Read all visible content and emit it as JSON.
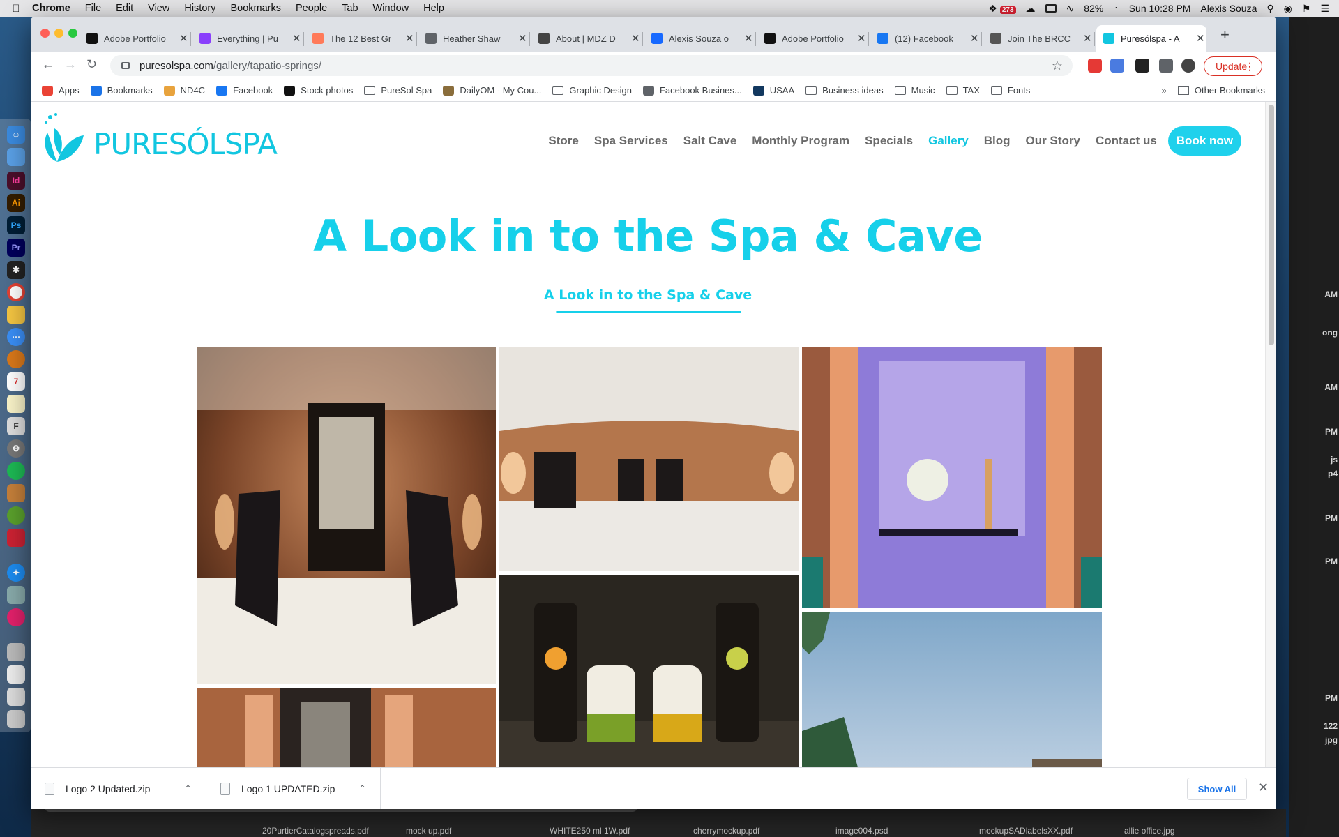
{
  "menubar": {
    "app": "Chrome",
    "items": [
      "File",
      "Edit",
      "View",
      "History",
      "Bookmarks",
      "People",
      "Tab",
      "Window",
      "Help"
    ],
    "dropbox_badge": "273",
    "battery": "82%",
    "clock": "Sun 10:28 PM",
    "user": "Alexis Souza"
  },
  "tabs": [
    {
      "label": "Adobe Portfolio",
      "icon": "adobe-portfolio-icon",
      "color": "#111111"
    },
    {
      "label": "Everything | Pu",
      "icon": "everything-icon",
      "color": "#8a3ffc"
    },
    {
      "label": "The 12 Best Gr",
      "icon": "hubspot-icon",
      "color": "#ff7a59"
    },
    {
      "label": "Heather Shaw",
      "icon": "globe-icon",
      "color": "#5f6368"
    },
    {
      "label": "About | MDZ D",
      "icon": "mdz-icon",
      "color": "#444444"
    },
    {
      "label": "Alexis Souza o",
      "icon": "behance-icon",
      "color": "#1769ff"
    },
    {
      "label": "Adobe Portfolio",
      "icon": "adobe-portfolio-icon",
      "color": "#111111"
    },
    {
      "label": "(12) Facebook",
      "icon": "facebook-icon",
      "color": "#1877f2"
    },
    {
      "label": "Join The BRCC",
      "icon": "brcc-icon",
      "color": "#555555"
    },
    {
      "label": "Puresólspa - A",
      "icon": "puresol-icon",
      "color": "#12c6e0",
      "active": true
    }
  ],
  "address": {
    "host": "puresolspa.com",
    "path": "/gallery/tapatio-springs/"
  },
  "update_label": "Update",
  "bookmarks": [
    {
      "label": "Apps",
      "icon": "apps-grid-icon"
    },
    {
      "label": "Bookmarks",
      "icon": "star-icon"
    },
    {
      "label": "ND4C",
      "icon": "nd4c-icon"
    },
    {
      "label": "Facebook",
      "icon": "facebook-icon"
    },
    {
      "label": "Stock photos",
      "icon": "stock-icon"
    },
    {
      "label": "PureSol Spa",
      "icon": "folder-icon"
    },
    {
      "label": "DailyOM - My Cou...",
      "icon": "dailyom-icon"
    },
    {
      "label": "Graphic Design",
      "icon": "folder-icon"
    },
    {
      "label": "Facebook Busines...",
      "icon": "facebook-business-icon"
    },
    {
      "label": "USAA",
      "icon": "usaa-icon"
    },
    {
      "label": "Business ideas",
      "icon": "folder-icon"
    },
    {
      "label": "Music",
      "icon": "folder-icon"
    },
    {
      "label": "TAX",
      "icon": "folder-icon"
    },
    {
      "label": "Fonts",
      "icon": "folder-icon"
    }
  ],
  "bookmarks_overflow": "»",
  "other_bookmarks": "Other Bookmarks",
  "site": {
    "logo": "PURESÓLSPA",
    "nav": [
      {
        "label": "Store"
      },
      {
        "label": "Spa Services"
      },
      {
        "label": "Salt Cave"
      },
      {
        "label": "Monthly Program"
      },
      {
        "label": "Specials"
      },
      {
        "label": "Gallery",
        "active": true
      },
      {
        "label": "Blog"
      },
      {
        "label": "Our Story"
      },
      {
        "label": "Contact us"
      }
    ],
    "book_now": "Book now",
    "title": "A Look in to the Spa & Cave",
    "subtitle": "A Look in to the Spa & Cave"
  },
  "downloads": [
    {
      "file": "Logo 2 Updated.zip"
    },
    {
      "file": "Logo 1 UPDATED.zip"
    }
  ],
  "show_all": "Show All",
  "desktop_right_times": [
    "AM",
    "ong",
    "AM",
    "PM",
    "js",
    "p4",
    "PM",
    "PM",
    "PM",
    "122",
    "jpg"
  ],
  "desktop_files": [
    "20PurtierCatalogspreads.pdf",
    "mock up.pdf",
    "WHITE250 ml 1W.pdf",
    "cherrymockup.pdf",
    "image004.psd",
    "mockupSADlabelsXX.pdf",
    "allie office.jpg"
  ],
  "colors": {
    "brand": "#16d0ea",
    "nav_text": "#6a6a6a",
    "update": "#d93025"
  }
}
